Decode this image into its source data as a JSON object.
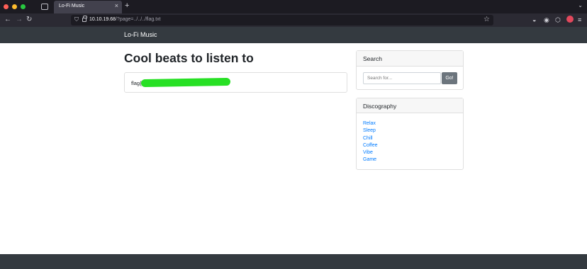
{
  "browser": {
    "tab_title": "Lo-Fi Music",
    "url_host": "10.10.19.68",
    "url_path": "/?page=../../../flag.txt",
    "icons": [
      "close-icon",
      "plus-icon",
      "back-icon",
      "forward-icon",
      "reload-icon",
      "shield-icon",
      "lock-icon",
      "star-icon",
      "pocket-icon",
      "account-icon",
      "extensions-icon",
      "menu-icon"
    ]
  },
  "site": {
    "brand": "Lo-Fi Music"
  },
  "main": {
    "title": "Cool beats to listen to",
    "flag_prefix": "flag{e"
  },
  "sidebar": {
    "search": {
      "header": "Search",
      "placeholder": "Search for...",
      "button": "Go!"
    },
    "discography": {
      "header": "Discography",
      "items": [
        "Relax",
        "Sleep",
        "Chill",
        "Coffee",
        "Vibe",
        "Game"
      ]
    }
  },
  "colors": {
    "navbar": "#343a40",
    "link": "#007bff",
    "redaction": "#27e024",
    "button": "#6c757d"
  }
}
